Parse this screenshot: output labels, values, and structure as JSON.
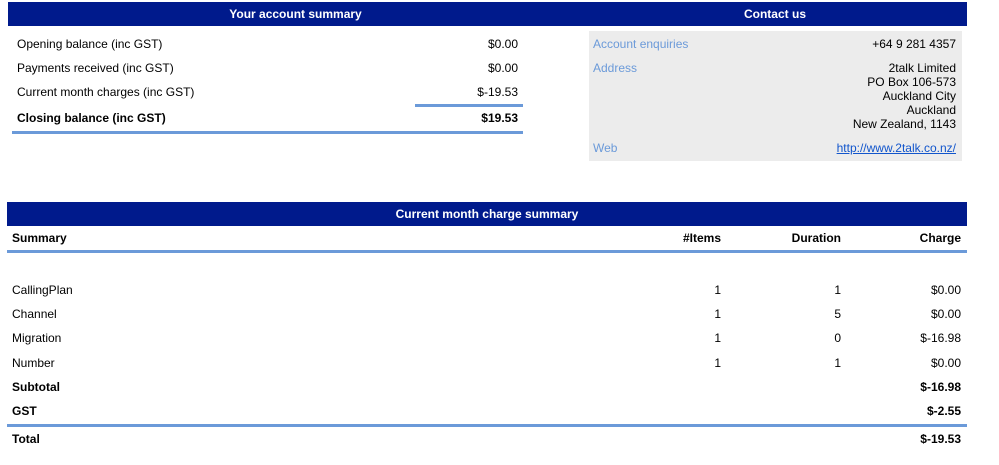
{
  "account_summary": {
    "header": "Your account summary",
    "rows": [
      {
        "label": "Opening balance (inc GST)",
        "value": "$0.00"
      },
      {
        "label": "Payments received (inc GST)",
        "value": "$0.00"
      },
      {
        "label": "Current month charges (inc GST)",
        "value": "$-19.53"
      }
    ],
    "closing": {
      "label": "Closing balance (inc GST)",
      "value": "$19.53"
    }
  },
  "contact": {
    "header": "Contact us",
    "account_enquiries_label": "Account enquiries",
    "account_enquiries_value": "+64 9 281 4357",
    "address_label": "Address",
    "address_lines": [
      "2talk Limited",
      "PO Box 106-573",
      "Auckland City",
      "Auckland",
      "New Zealand, 1143"
    ],
    "web_label": "Web",
    "web_value": "http://www.2talk.co.nz/"
  },
  "charge_summary": {
    "header": "Current month charge summary",
    "columns": {
      "summary": "Summary",
      "items": "#Items",
      "duration": "Duration",
      "charge": "Charge"
    },
    "rows": [
      {
        "summary": "CallingPlan",
        "items": "1",
        "duration": "1",
        "charge": "$0.00"
      },
      {
        "summary": "Channel",
        "items": "1",
        "duration": "5",
        "charge": "$0.00"
      },
      {
        "summary": "Migration",
        "items": "1",
        "duration": "0",
        "charge": "$-16.98"
      },
      {
        "summary": "Number",
        "items": "1",
        "duration": "1",
        "charge": "$0.00"
      }
    ],
    "subtotal": {
      "label": "Subtotal",
      "charge": "$-16.98"
    },
    "gst": {
      "label": "GST",
      "charge": "$-2.55"
    },
    "total": {
      "label": "Total",
      "charge": "$-19.53"
    }
  },
  "colors": {
    "header_bg": "#001a8c",
    "rule": "#6b9ad9",
    "contact_bg": "#ececec",
    "link": "#1155cc"
  }
}
